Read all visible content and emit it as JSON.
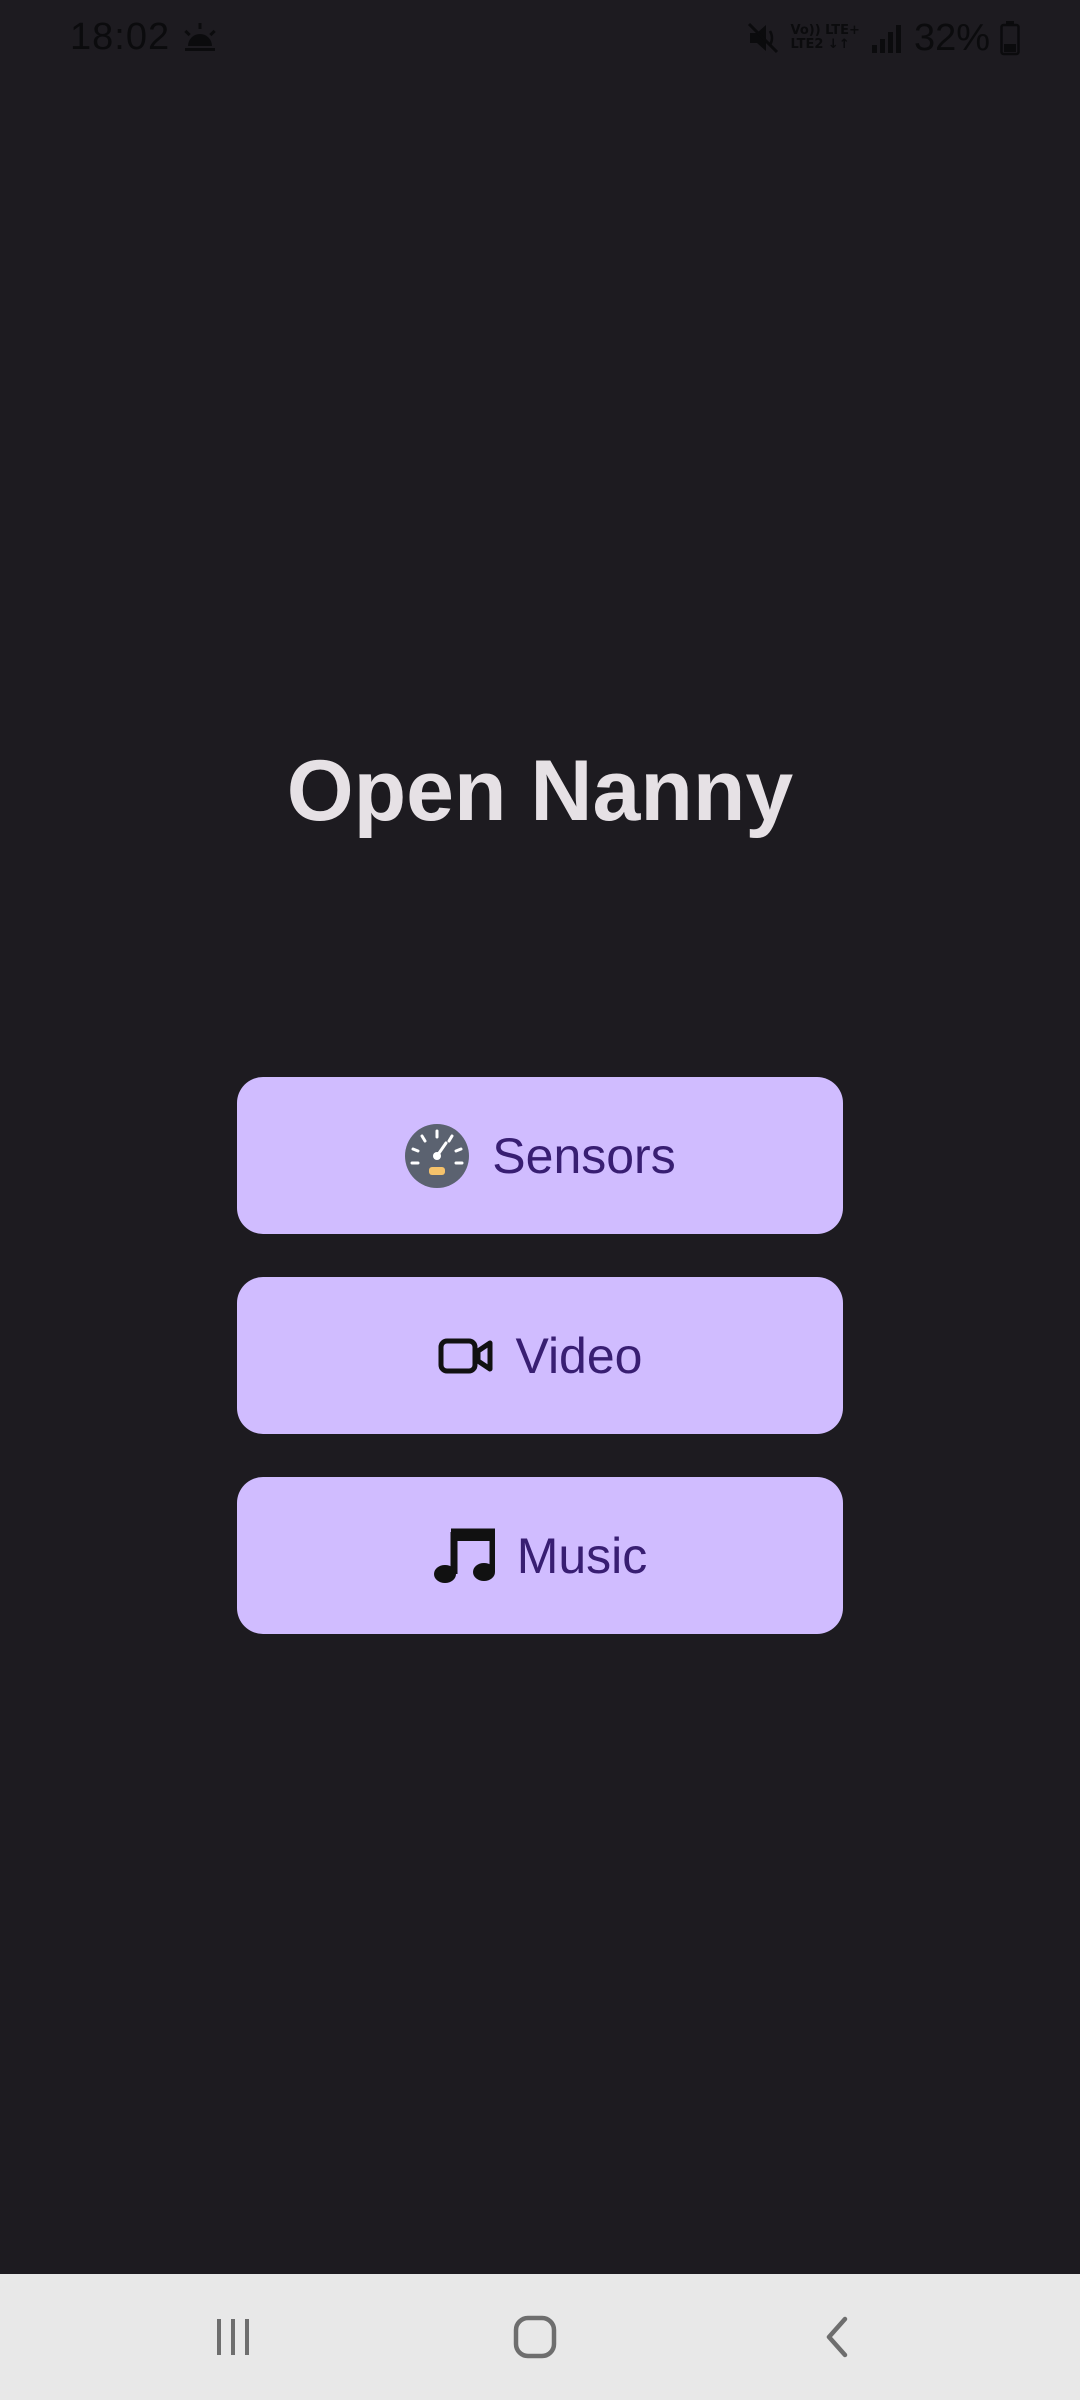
{
  "status_bar": {
    "time": "18:02",
    "battery": "32%",
    "network_line1": "Vo)) LTE+",
    "network_line2": "LTE2 ↓↑",
    "icons": [
      "weather-icon",
      "mute-icon",
      "signal-icon",
      "battery-icon"
    ]
  },
  "app": {
    "title": "Open Nanny"
  },
  "buttons": {
    "sensors": {
      "label": "Sensors",
      "icon": "speedometer-icon"
    },
    "video": {
      "label": "Video",
      "icon": "video-camera-icon"
    },
    "music": {
      "label": "Music",
      "icon": "music-note-icon"
    }
  },
  "nav_bar": {
    "items": [
      "recents",
      "home",
      "back"
    ]
  },
  "colors": {
    "background": "#1d1b20",
    "button": "#d0bcff",
    "button_text": "#381e72",
    "title": "#e6e1e5",
    "nav_bar": "#e8e8e8"
  }
}
